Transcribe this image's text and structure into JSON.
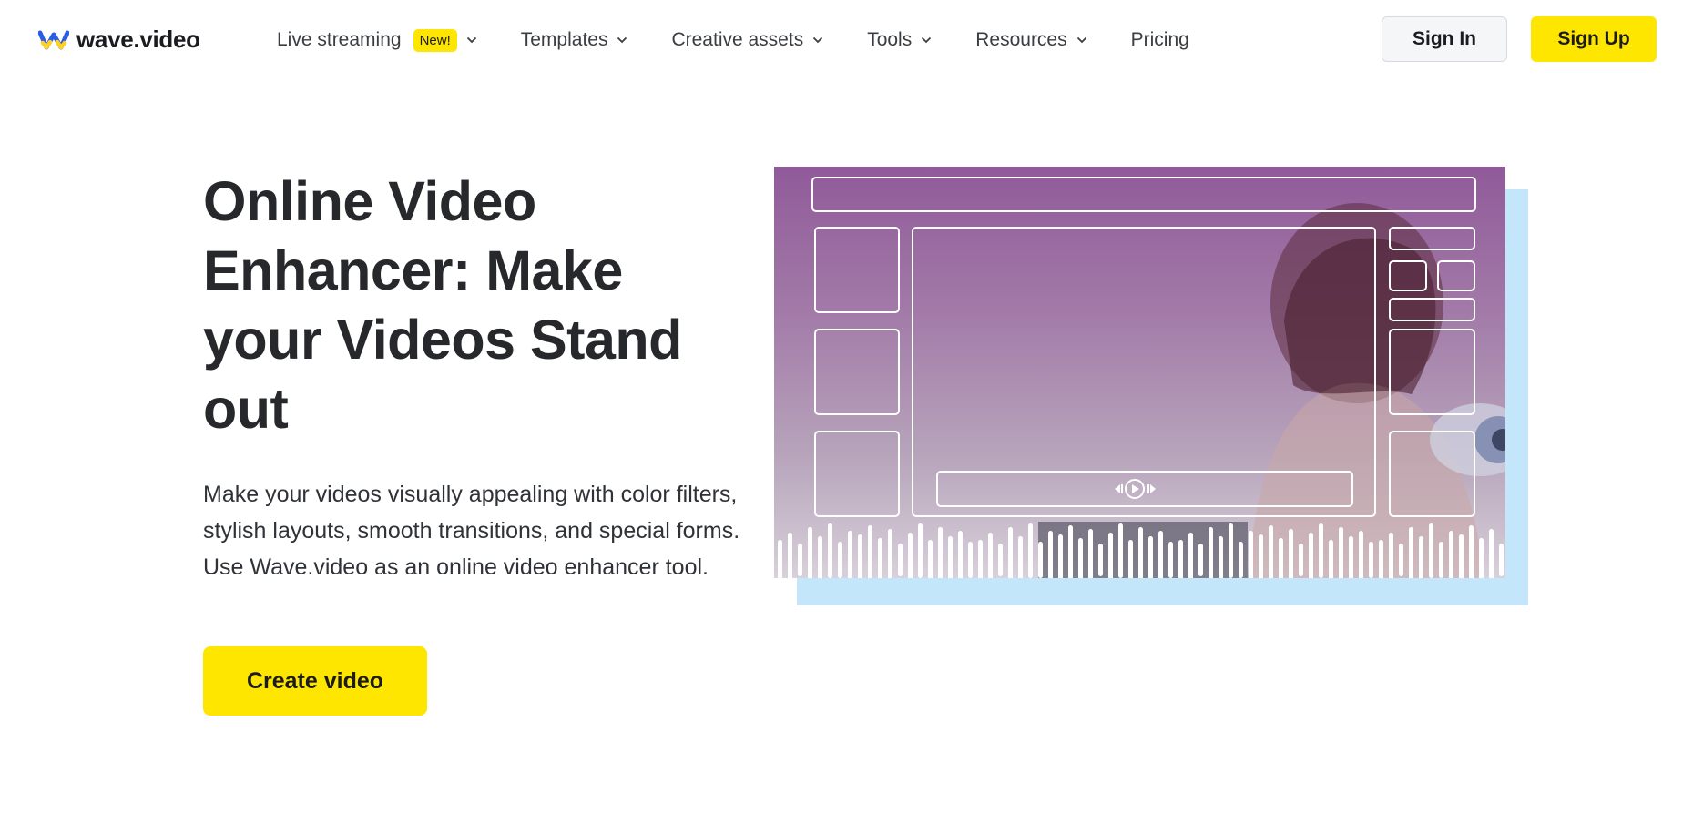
{
  "brand": {
    "name": "wave.video",
    "accent": "#ffe600",
    "logo_colors": [
      "#2b5ce6",
      "#ffd21f"
    ]
  },
  "nav": {
    "items": [
      {
        "label": "Live streaming",
        "badge": "New!",
        "dropdown": true
      },
      {
        "label": "Templates",
        "dropdown": true
      },
      {
        "label": "Creative assets",
        "dropdown": true
      },
      {
        "label": "Tools",
        "dropdown": true
      },
      {
        "label": "Resources",
        "dropdown": true
      },
      {
        "label": "Pricing",
        "dropdown": false
      }
    ]
  },
  "auth": {
    "sign_in": "Sign In",
    "sign_up": "Sign Up"
  },
  "hero": {
    "title": "Online Video Enhancer: Make your Videos Stand out",
    "description": "Make your videos visually appealing with color filters, stylish layouts, smooth transitions, and special forms. Use Wave.video as an online video enhancer tool.",
    "cta": "Create video"
  },
  "illustration": {
    "icons": [
      "rewind-icon",
      "play-icon",
      "forward-icon"
    ],
    "colors": {
      "frame": "#905a99",
      "shadow": "#c4e6fb",
      "outline": "#ffffff"
    }
  }
}
